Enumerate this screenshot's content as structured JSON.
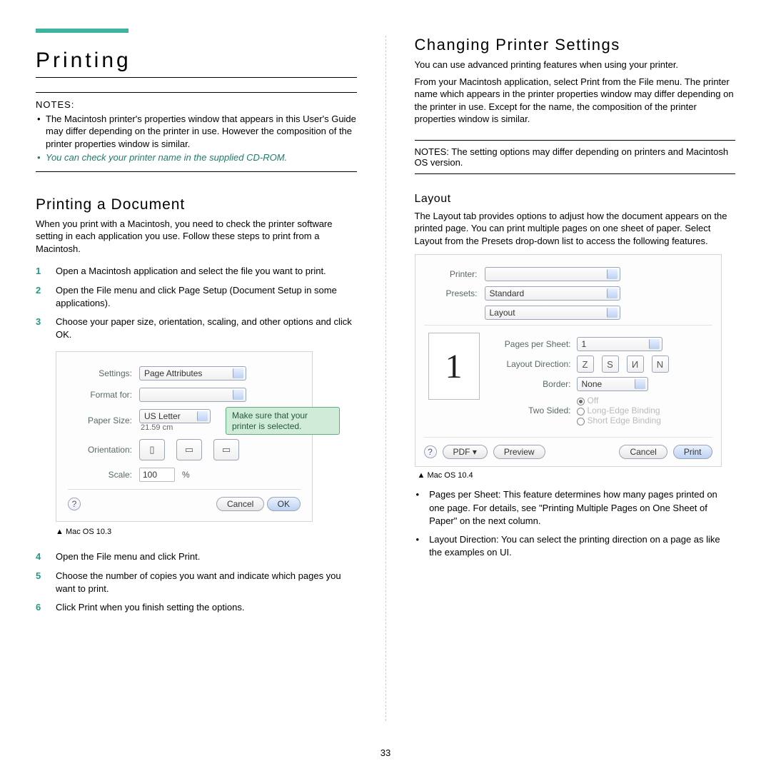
{
  "page_number": "33",
  "left": {
    "main_title": "Printing",
    "notes_label": "NOTES:",
    "note1": "The Macintosh printer's properties window that appears in this User's Guide may differ depending on the printer in use. However the composition of the printer properties window is similar.",
    "note2": "You can check your printer name in the supplied CD-ROM.",
    "section_title": "Printing a Document",
    "intro": "When you print with a Macintosh, you need to check the printer software setting in each application you use. Follow these steps to print from a Macintosh.",
    "steps": [
      "Open a Macintosh application and select the file you want to print.",
      "Open the File menu and click Page Setup (Document Setup in some applications).",
      "Choose your paper size, orientation, scaling, and other options and click OK."
    ],
    "panel": {
      "settings_label": "Settings:",
      "settings_value": "Page Attributes",
      "format_label": "Format for:",
      "paper_label": "Paper Size:",
      "paper_value": "US Letter",
      "paper_sub": "21.59 cm",
      "orientation_label": "Orientation:",
      "scale_label": "Scale:",
      "scale_value": "100",
      "scale_unit": "%",
      "cancel": "Cancel",
      "ok": "OK",
      "callout": "Make sure that your printer is selected."
    },
    "caption1": "▲ Mac OS 10.3",
    "steps2": [
      "Open the File menu and click Print.",
      "Choose the number of copies you want and indicate which pages you want to print.",
      "Click Print when you finish setting the options."
    ]
  },
  "right": {
    "title": "Changing Printer Settings",
    "p1": "You can use advanced printing features when using your printer.",
    "p2": "From your Macintosh application, select Print from the File menu. The printer name which appears in the printer properties window may differ depending on the printer in use. Except for the name, the composition of the printer properties window is similar.",
    "notes2": "NOTES: The setting options may differ depending on printers and Macintosh OS version.",
    "layout_heading": "Layout",
    "layout_body": "The Layout tab provides options to adjust how the document appears on the printed page. You can print multiple pages on one sheet of paper. Select Layout from the Presets drop-down list to access the following features.",
    "panel": {
      "printer_label": "Printer:",
      "presets_label": "Presets:",
      "presets_value": "Standard",
      "section_value": "Layout",
      "pps_label": "Pages per Sheet:",
      "pps_value": "1",
      "dir_label": "Layout Direction:",
      "border_label": "Border:",
      "border_value": "None",
      "twosided_label": "Two Sided:",
      "ts_off": "Off",
      "ts_long": "Long-Edge Binding",
      "ts_short": "Short Edge Binding",
      "help": "?",
      "pdf": "PDF ▾",
      "preview": "Preview",
      "cancel": "Cancel",
      "print": "Print",
      "preview_num": "1"
    },
    "caption2": "▲ Mac OS 10.4",
    "feat1": "Pages per Sheet: This feature determines how many pages printed on one page. For details, see \"Printing Multiple Pages on One Sheet of Paper\" on the next column.",
    "feat2": "Layout Direction: You can select the printing direction on a page as like the examples on UI."
  }
}
